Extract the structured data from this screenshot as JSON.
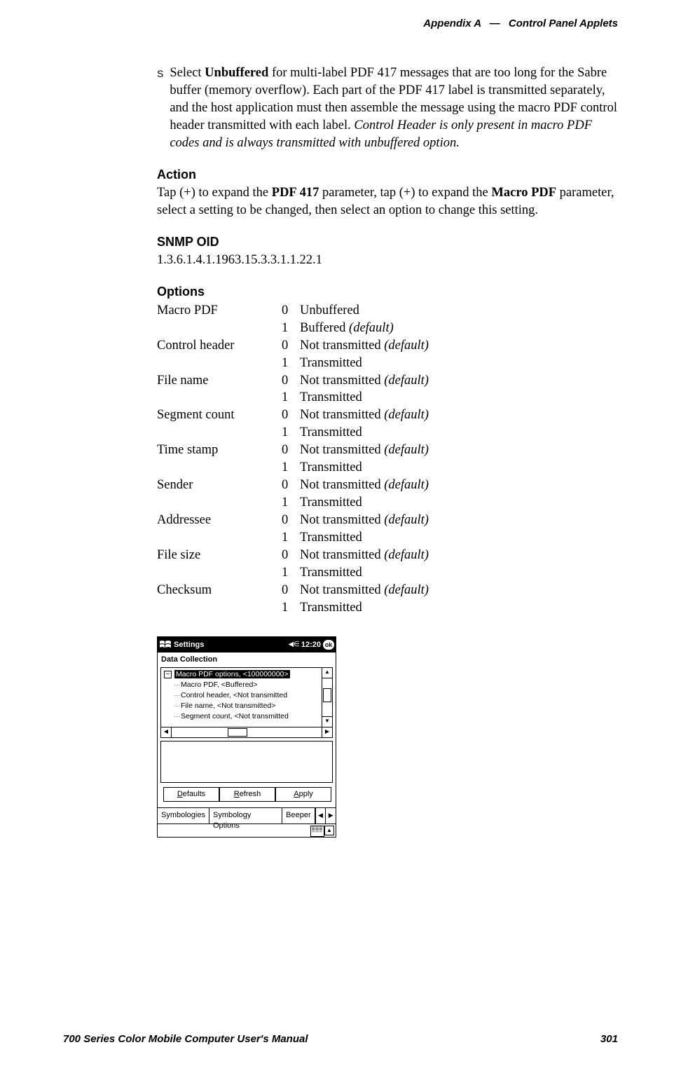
{
  "header": {
    "appendix": "Appendix A",
    "dash": "—",
    "title": "Control Panel Applets"
  },
  "bullet": {
    "pre": "Select ",
    "strong": "Unbuffered",
    "body": " for multi-label PDF 417 messages that are too long for the Sabre buffer (memory overflow). Each part of the PDF 417 label is transmitted separately, and the host application must then assemble the message using the macro PDF control header transmitted with each label. ",
    "italic": "Control Header is only present in macro PDF codes and is always transmitted with unbuffered option."
  },
  "action": {
    "head": "Action",
    "t1": "Tap (+) to expand the ",
    "b1": "PDF 417",
    "t2": " parameter, tap (+) to expand the ",
    "b2": "Macro PDF",
    "t3": " parameter, select a setting to be changed, then select an option to change this setting."
  },
  "snmp": {
    "head": "SNMP OID",
    "value": "1.3.6.1.4.1.1963.15.3.3.1.1.22.1"
  },
  "options": {
    "head": "Options",
    "rows": [
      {
        "name": "Macro PDF",
        "o0": "Unbuffered",
        "o1": "Buffered ",
        "o1def": "(default)"
      },
      {
        "name": "Control header",
        "o0": "Not transmitted ",
        "o0def": "(default)",
        "o1": "Transmitted"
      },
      {
        "name": "File name",
        "o0": "Not transmitted ",
        "o0def": "(default)",
        "o1": "Transmitted"
      },
      {
        "name": "Segment count",
        "o0": "Not transmitted ",
        "o0def": "(default)",
        "o1": "Transmitted"
      },
      {
        "name": "Time stamp",
        "o0": "Not transmitted ",
        "o0def": "(default)",
        "o1": "Transmitted"
      },
      {
        "name": "Sender",
        "o0": "Not transmitted ",
        "o0def": "(default)",
        "o1": "Transmitted"
      },
      {
        "name": "Addressee",
        "o0": "Not transmitted ",
        "o0def": "(default)",
        "o1": "Transmitted"
      },
      {
        "name": "File size",
        "o0": "Not transmitted ",
        "o0def": "(default)",
        "o1": "Transmitted"
      },
      {
        "name": "Checksum",
        "o0": "Not transmitted ",
        "o0def": "(default)",
        "o1": "Transmitted"
      }
    ]
  },
  "shot": {
    "title": "Settings",
    "time": "12:20",
    "ok": "ok",
    "dc": "Data Collection",
    "tree": {
      "sel": "Macro PDF options, <100000000>",
      "r1": "Macro PDF, <Buffered>",
      "r2": "Control header, <Not transmitted",
      "r3": "File name, <Not transmitted>",
      "r4": "Segment count, <Not transmitted"
    },
    "btns": {
      "defaults_u": "D",
      "defaults_r": "efaults",
      "refresh_u": "R",
      "refresh_r": "efresh",
      "apply_u": "A",
      "apply_r": "pply"
    },
    "tabs": {
      "t1": "Symbologies",
      "t2": "Symbology Options",
      "t3": "Beeper"
    }
  },
  "footer": {
    "left": "700 Series Color Mobile Computer User's Manual",
    "right": "301"
  }
}
